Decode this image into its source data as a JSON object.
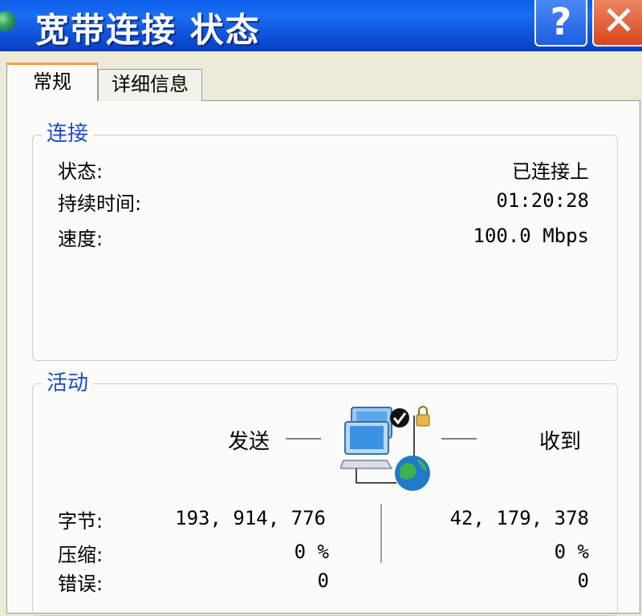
{
  "window": {
    "title": "宽带连接 状态",
    "help_glyph": "?",
    "close_glyph": "✕"
  },
  "tabs": [
    {
      "label": "常规",
      "active": true
    },
    {
      "label": "详细信息",
      "active": false
    }
  ],
  "connection": {
    "title": "连接",
    "status_label": "状态:",
    "status_value": "已连接上",
    "duration_label": "持续时间:",
    "duration_value": "01:20:28",
    "speed_label": "速度:",
    "speed_value": "100.0 Mbps"
  },
  "activity": {
    "title": "活动",
    "sent_label": "发送",
    "received_label": "收到",
    "bytes_label": "字节:",
    "bytes_sent": "193, 914, 776",
    "bytes_received": "42, 179, 378",
    "compression_label": "压缩:",
    "compression_sent": "0 %",
    "compression_received": "0 %",
    "errors_label": "错误:",
    "errors_sent": "0",
    "errors_received": "0"
  },
  "icons": {
    "title": "network-globe-icon",
    "activity": "network-computers-icon"
  },
  "colors": {
    "title_bar": "#0a5ee8",
    "group_title": "#1d4cc8",
    "close_button": "#d8461e",
    "active_tab_accent": "#f0a33a"
  }
}
